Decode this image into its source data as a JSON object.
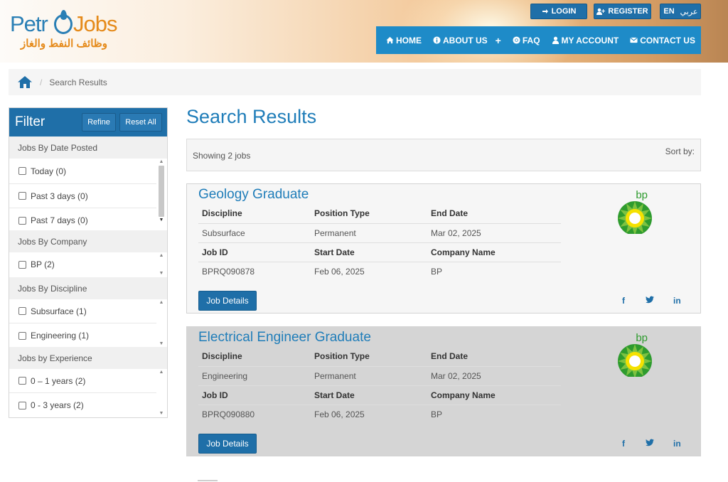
{
  "header": {
    "logo_word_1": "Petr",
    "logo_word_2": "Jobs",
    "logo_arabic": "وظائف النفط والغاز",
    "login_label": "LOGIN",
    "register_label": "REGISTER",
    "lang_en": "EN",
    "lang_ar": "عربي",
    "nav": {
      "home": "HOME",
      "about": "ABOUT US",
      "about_plus": "+",
      "faq": "FAQ",
      "account": "MY ACCOUNT",
      "contact": "CONTACT US"
    }
  },
  "breadcrumb": {
    "icon": "home-icon",
    "separator": "/",
    "current": "Search Results"
  },
  "filter": {
    "title": "Filter",
    "refine_label": "Refine",
    "reset_label": "Reset All",
    "groups": [
      {
        "title": "Jobs By Date Posted",
        "options": [
          "Today (0)",
          "Past 3 days (0)",
          "Past 7 days (0)"
        ]
      },
      {
        "title": "Jobs By Company",
        "options": [
          "BP (2)"
        ]
      },
      {
        "title": "Jobs By Discipline",
        "options": [
          "Subsurface (1)",
          "Engineering (1)"
        ]
      },
      {
        "title": "Jobs by Experience",
        "options": [
          "0 – 1 years (2)",
          "0 - 3 years (2)"
        ]
      }
    ]
  },
  "main": {
    "title": "Search Results",
    "showing": "Showing 2 jobs",
    "sort_by": "Sort by:"
  },
  "job_labels": {
    "discipline": "Discipline",
    "position_type": "Position Type",
    "end_date": "End Date",
    "job_id": "Job ID",
    "start_date": "Start Date",
    "company_name": "Company Name",
    "details_button": "Job Details",
    "facebook": "f",
    "linkedin": "in"
  },
  "jobs": [
    {
      "title": "Geology Graduate",
      "discipline": "Subsurface",
      "position_type": "Permanent",
      "end_date": "Mar 02, 2025",
      "job_id": "BPRQ090878",
      "start_date": "Feb 06, 2025",
      "company_name": "BP",
      "logo_text": "bp"
    },
    {
      "title": "Electrical Engineer Graduate",
      "discipline": "Engineering",
      "position_type": "Permanent",
      "end_date": "Mar 02, 2025",
      "job_id": "BPRQ090880",
      "start_date": "Feb 06, 2025",
      "company_name": "BP",
      "logo_text": "bp"
    }
  ],
  "colors": {
    "brand_blue": "#1f6fa8",
    "nav_blue": "#1e8bc8",
    "title_blue": "#1f7db9",
    "logo_orange": "#e58a1a",
    "bp_green": "#2e9b2e",
    "bp_yellow": "#f5e100"
  }
}
